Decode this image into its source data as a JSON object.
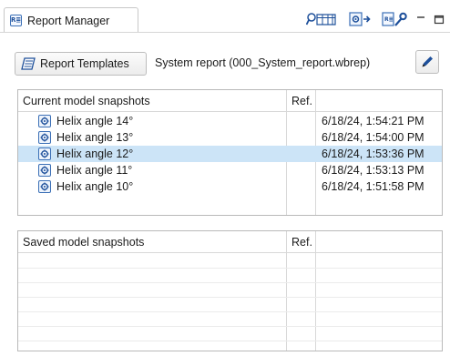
{
  "view": {
    "tab_icon_text": "R≣",
    "tab_label": "Report Manager"
  },
  "toolbar": {
    "report_templates_label": "Report Templates",
    "report_name": "System report (000_System_report.wbrep)"
  },
  "current_table": {
    "col_name": "Current model snapshots",
    "col_ref": "Ref.",
    "rows": [
      {
        "name": "Helix angle 14°",
        "date": "6/18/24, 1:54:21 PM",
        "selected": false
      },
      {
        "name": "Helix angle 13°",
        "date": "6/18/24, 1:54:00 PM",
        "selected": false
      },
      {
        "name": "Helix angle 12°",
        "date": "6/18/24, 1:53:36 PM",
        "selected": true
      },
      {
        "name": "Helix angle 11°",
        "date": "6/18/24, 1:53:13 PM",
        "selected": false
      },
      {
        "name": "Helix angle 10°",
        "date": "6/18/24, 1:51:58 PM",
        "selected": false
      }
    ]
  },
  "saved_table": {
    "col_name": "Saved model snapshots",
    "col_ref": "Ref."
  },
  "colors": {
    "selection": "#cce4f7",
    "icon_blue": "#3b6fb6",
    "border": "#b9b9b9"
  },
  "icons": [
    "report-icon",
    "search-table-icon",
    "snapshot-export-icon",
    "report-tools-icon",
    "minimize-icon",
    "maximize-icon",
    "template-book-icon",
    "pencil-icon",
    "snapshot-icon"
  ]
}
